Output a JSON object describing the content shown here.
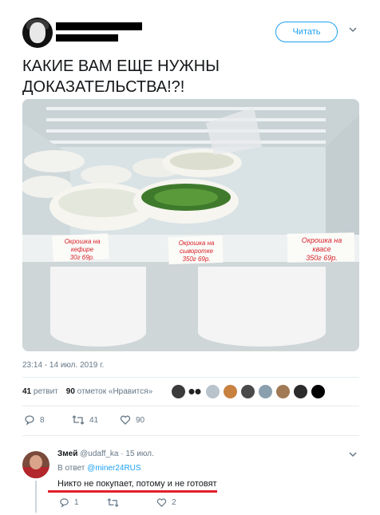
{
  "tweet": {
    "follow_label": "Читать",
    "text": "КАКИЕ ВАМ ЕЩЕ НУЖНЫ ДОКАЗАТЕЛЬСТВА!?!",
    "timestamp": "23:14 - 14 июл. 2019 г.",
    "retweets_count": "41",
    "retweets_label": "ретвит",
    "likes_count": "90",
    "likes_label": "отметок «Нравится»",
    "actions": {
      "replies": "8",
      "retweets": "41",
      "likes": "90"
    },
    "photo_labels": {
      "left": [
        "Окрошка на",
        "кефире",
        "30г 69р."
      ],
      "middle": [
        "Окрошка на",
        "сыворотке",
        "350г 69р."
      ],
      "right": [
        "Окрошка на",
        "квасе",
        "350г 69р."
      ]
    }
  },
  "reply": {
    "name": "Змей",
    "handle": "@udaff_ka",
    "date": "· 15 июл.",
    "in_reply_prefix": "В ответ",
    "in_reply_handle": "@miner24RUS",
    "text": "Никто не покупает, потому и не готовят",
    "actions": {
      "replies": "1",
      "retweets": "",
      "likes": "2"
    }
  },
  "colors": {
    "accent": "#1da1f2",
    "underline": "#e0202a",
    "muted": "#657786"
  }
}
